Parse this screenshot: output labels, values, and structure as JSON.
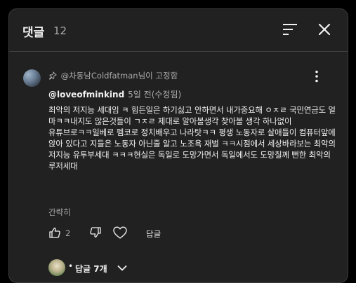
{
  "header": {
    "title": "댓글",
    "count": "12"
  },
  "comment": {
    "pinned_text": "@차동남Coldfatman님이 고정함",
    "author": "@loveofminkind",
    "date": "5일 전(수정됨)",
    "body": "최악의 저지능 세대임 ㅋ 힘든일은  하기싫고  안하면서 내가중요해  ㅇㅈㄹ  국민연금도  얼마ㅋㅋ내지도 않은것들이 ㄱㅈㄹ  제대로 알아볼생각 찾아볼 생각 하나없이\n유튜브로ㅋㅋ일베로  펨코로   정치배우고    나라탓ㅋㅋ  평생  노동자로  살애들이 컴퓨터앞에 앉아 있다고  지들은  노동자  아닌줄  알고 노조욕 재벌 ㅋㅋ시점에서  세상바라보는  최악의 저지능 유투부세대  ㅋㅋㅋ현실은  독일로 도망가면서  독일에서도  도망칠께  뻔한  최악의  루저세대",
    "read_more": "간략히",
    "like_count": "2",
    "reply_label": "답글"
  },
  "replies": {
    "dot": "•",
    "label": "답글 7개"
  },
  "icons": [
    "pin-icon",
    "sort-icon",
    "close-icon",
    "more-vert-icon",
    "thumbs-up-icon",
    "thumbs-down-icon",
    "heart-icon",
    "chevron-down-icon"
  ]
}
